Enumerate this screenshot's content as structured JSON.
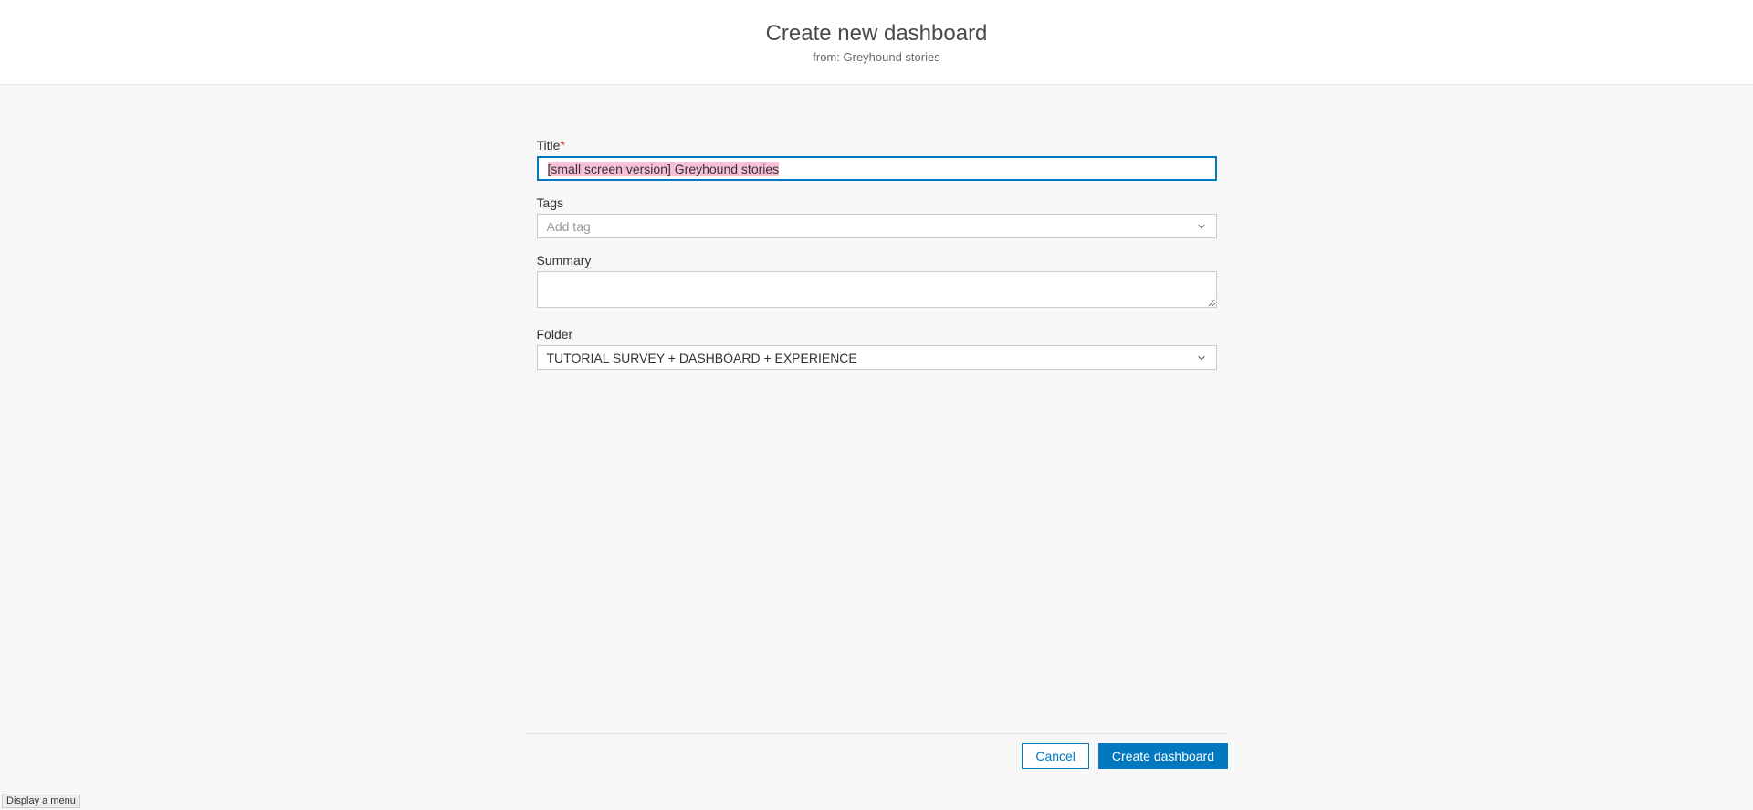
{
  "header": {
    "title": "Create new dashboard",
    "from_prefix": "from: ",
    "from_name": "Greyhound stories"
  },
  "form": {
    "title": {
      "label": "Title",
      "required_marker": "*",
      "value": "[small screen version] Greyhound stories"
    },
    "tags": {
      "label": "Tags",
      "placeholder": "Add tag"
    },
    "summary": {
      "label": "Summary",
      "value": ""
    },
    "folder": {
      "label": "Folder",
      "selected": "TUTORIAL SURVEY + DASHBOARD + EXPERIENCE"
    }
  },
  "footer": {
    "cancel": "Cancel",
    "create": "Create dashboard"
  },
  "statusbar": {
    "hint": "Display a menu"
  },
  "colors": {
    "accent": "#0079c1",
    "danger": "#c6332b",
    "body_bg": "#f7f7f7",
    "border": "#cacaca"
  }
}
